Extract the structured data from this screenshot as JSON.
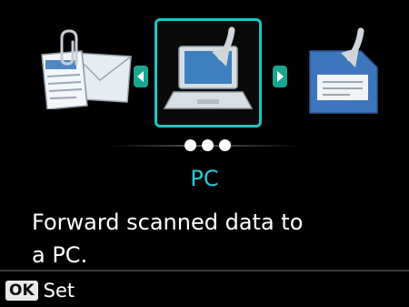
{
  "carousel": {
    "items": [
      {
        "name": "email",
        "icon": "envelope-attachment-icon"
      },
      {
        "name": "pc",
        "icon": "laptop-download-icon",
        "selected": true
      },
      {
        "name": "media",
        "icon": "memory-card-download-icon"
      }
    ],
    "accent": "#1fc4c4",
    "arrow_color": "#1aa68f",
    "page_dots": 3
  },
  "option": {
    "title": "PC",
    "description": "Forward scanned data to\na PC."
  },
  "footer": {
    "ok_key": "OK",
    "ok_action": "Set"
  }
}
